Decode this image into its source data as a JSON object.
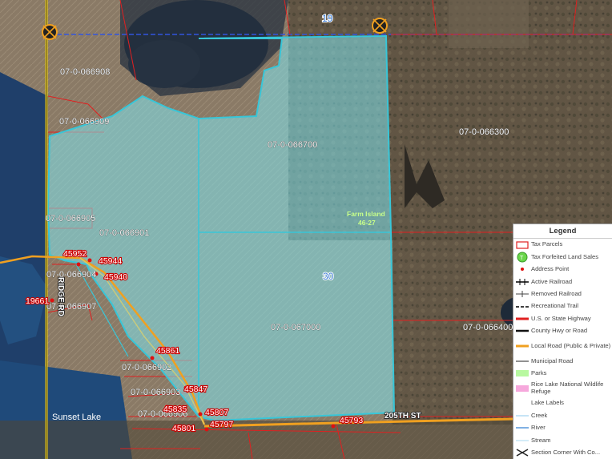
{
  "map": {
    "parcels": [
      {
        "id": "p1",
        "label": "07-0-066908"
      },
      {
        "id": "p2",
        "label": "07-0-066909"
      },
      {
        "id": "p3",
        "label": "07-0-066300"
      },
      {
        "id": "p4",
        "label": "07-0-066700"
      },
      {
        "id": "p5",
        "label": "07-0-066905"
      },
      {
        "id": "p6",
        "label": "07-0-066901"
      },
      {
        "id": "p7",
        "label": "07-0-066904"
      },
      {
        "id": "p8",
        "label": "07-0-066907"
      },
      {
        "id": "p9",
        "label": "07-0-067000"
      },
      {
        "id": "p10",
        "label": "07-0-066400"
      },
      {
        "id": "p11",
        "label": "07-0-066902"
      },
      {
        "id": "p12",
        "label": "07-0-066903"
      },
      {
        "id": "p13",
        "label": "07-0-066906"
      }
    ],
    "addresses": [
      "45952",
      "45944",
      "45940",
      "19661",
      "45861",
      "45847",
      "45835",
      "45807",
      "45801",
      "45797",
      "45793"
    ],
    "section_numbers": [
      "19",
      "30"
    ],
    "township_label": [
      "Farm Island",
      "46-27"
    ],
    "roads": [
      "205TH ST",
      "RIDGE RD"
    ],
    "lake_label": "Sunset Lake",
    "colors": {
      "forfeited_fill": "#7fe3ef",
      "forfeited_stroke": "#38c6d8",
      "tax_parcel": "#e02020",
      "local_road": "#f0a020",
      "section_line": "#3355dd"
    }
  },
  "legend": {
    "title": "Legend",
    "items": [
      {
        "label": "Tax Parcels",
        "icon": "parcel-outline-icon"
      },
      {
        "label": "Tax Forfeited Land Sales",
        "icon": "tf-green-circle-icon"
      },
      {
        "label": "Address Point",
        "icon": "red-dot-icon"
      },
      {
        "label": "Active Railroad",
        "icon": "railroad-icon"
      },
      {
        "label": "Removed Railroad",
        "icon": "removed-railroad-icon"
      },
      {
        "label": "Recreational Trail",
        "icon": "dashed-line-icon"
      },
      {
        "label": "U.S. or State Highway",
        "icon": "red-line-icon"
      },
      {
        "label": "County Hwy or Road",
        "icon": "black-line-icon"
      },
      {
        "label": "Local Road (Public & Private)",
        "icon": "orange-line-icon"
      },
      {
        "label": "Municipal Road",
        "icon": "thin-black-line-icon"
      },
      {
        "label": "Parks",
        "icon": "green-fill-icon"
      },
      {
        "label": "Rice Lake National Wildlife Refuge",
        "icon": "pink-fill-icon"
      },
      {
        "label": "Lake Labels",
        "icon": "none"
      },
      {
        "label": "Creek",
        "icon": "light-blue-line-icon"
      },
      {
        "label": "River",
        "icon": "blue-line-icon"
      },
      {
        "label": "Stream",
        "icon": "pale-blue-line-icon"
      },
      {
        "label": "Section Corner With Co...",
        "icon": "section-corner-icon"
      }
    ]
  }
}
